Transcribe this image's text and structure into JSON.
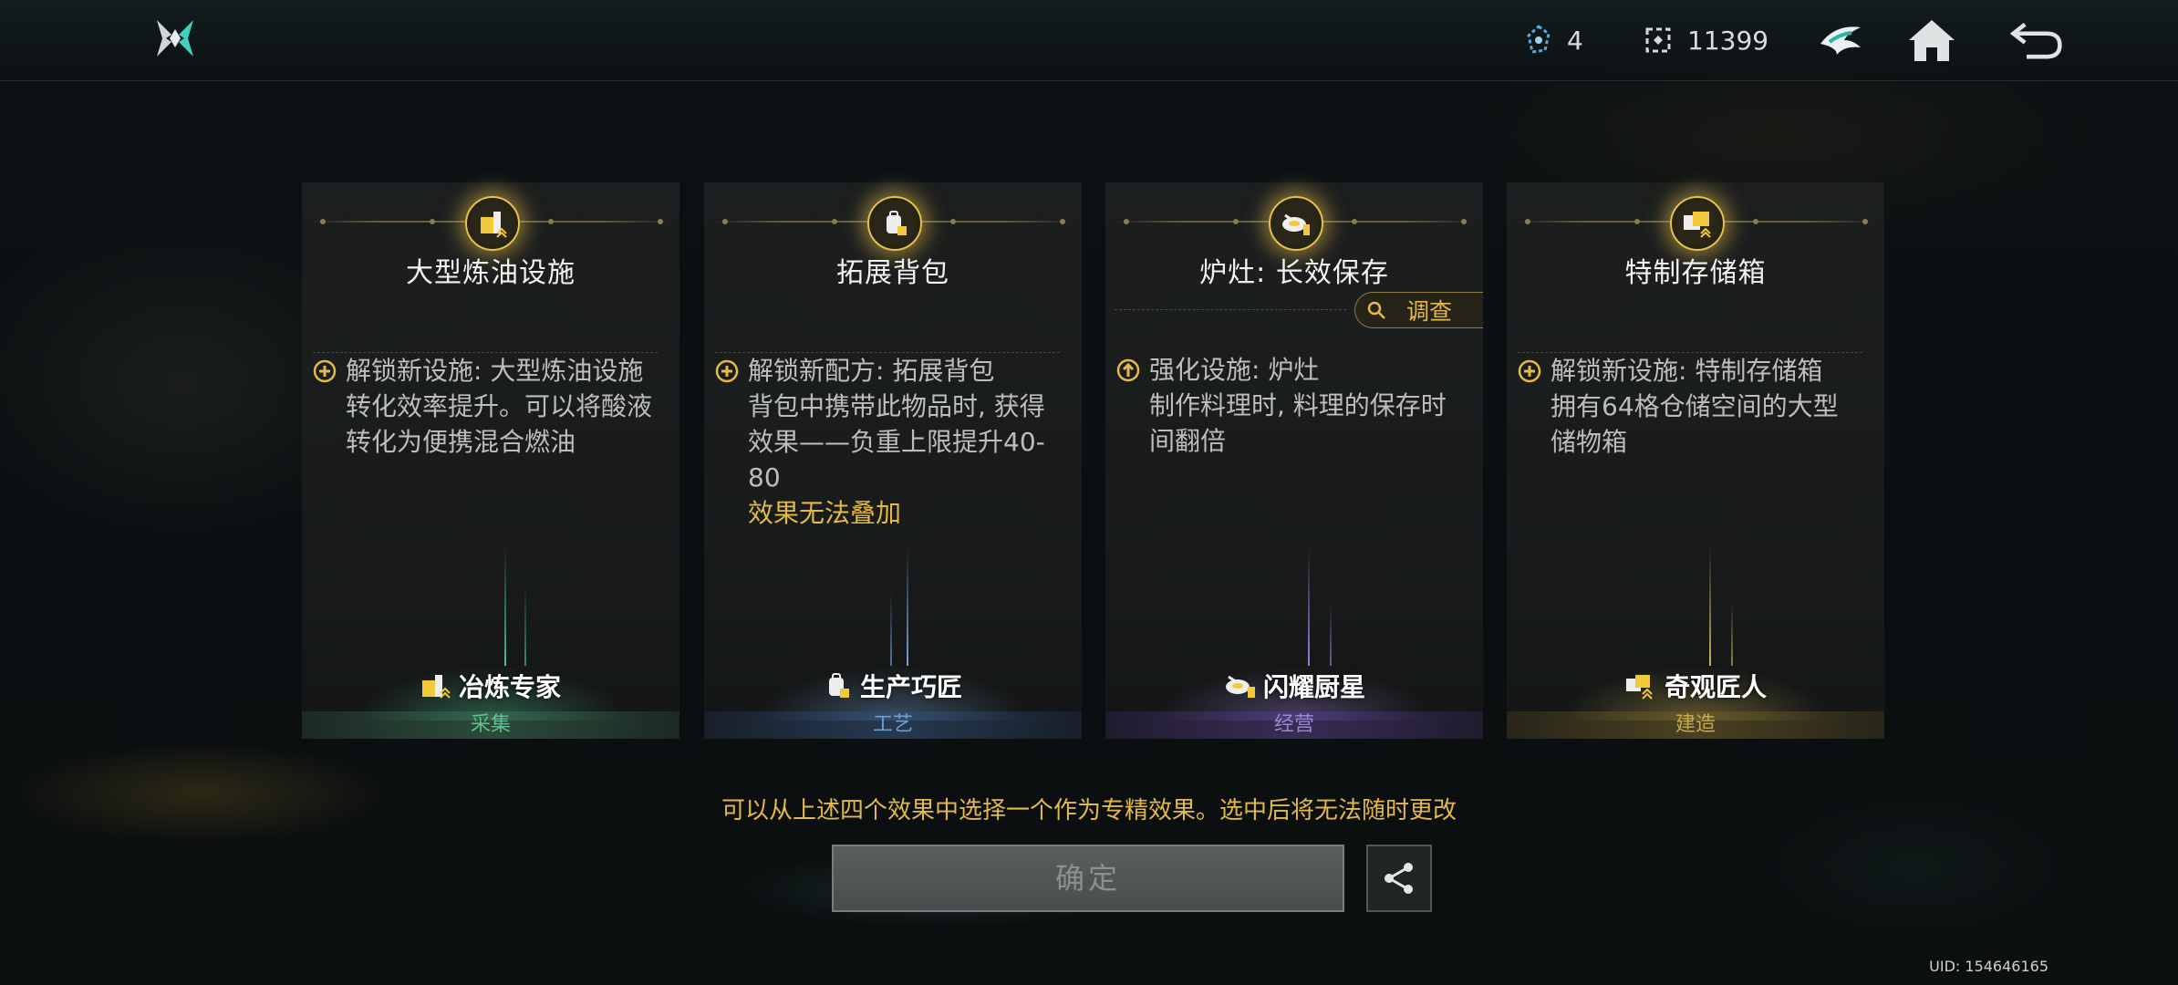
{
  "topbar": {
    "resource1_value": "4",
    "resource2_value": "11399"
  },
  "cards": [
    {
      "title": "大型炼油设施",
      "effect_lines": [
        "解锁新设施: 大型炼油设施",
        "转化效率提升。可以将酸液",
        "转化为便携混合燃油"
      ],
      "warning": "",
      "role": "冶炼专家",
      "category": "采集",
      "accent": "#4fd6a0"
    },
    {
      "title": "拓展背包",
      "effect_lines": [
        "解锁新配方: 拓展背包",
        "背包中携带此物品时, 获得",
        "效果——负重上限提升40-",
        "80"
      ],
      "warning": "效果无法叠加",
      "role": "生产巧匠",
      "category": "工艺",
      "accent": "#7fb4f0"
    },
    {
      "title": "炉灶: 长效保存",
      "effect_lines": [
        "强化设施: 炉灶",
        "制作料理时, 料理的保存时",
        "间翻倍"
      ],
      "warning": "",
      "role": "闪耀厨星",
      "category": "经营",
      "accent": "#a88af0",
      "investigate_label": "调查"
    },
    {
      "title": "特制存储箱",
      "effect_lines": [
        "解锁新设施: 特制存储箱",
        "拥有64格仓储空间的大型",
        "储物箱"
      ],
      "warning": "",
      "role": "奇观匠人",
      "category": "建造",
      "accent": "#e3c35a"
    }
  ],
  "hint": "可以从上述四个效果中选择一个作为专精效果。选中后将无法随时更改",
  "confirm_label": "确定",
  "uid": "UID: 154646165",
  "colors": {
    "gold": "#e3b94a",
    "badge_ring": "#e7c14a",
    "button_disabled": "#4f5252"
  }
}
